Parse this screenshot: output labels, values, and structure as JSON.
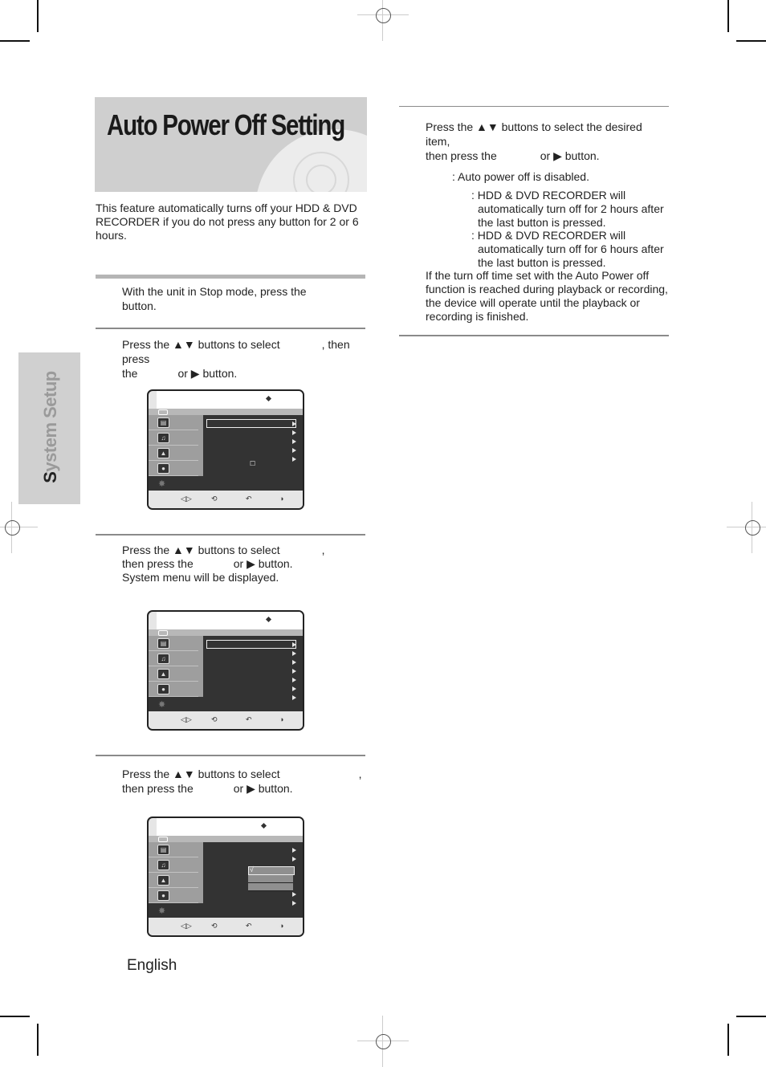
{
  "page": {
    "title": "Auto Power Off Setting",
    "section_tab": "System Setup",
    "language_label": "English",
    "intro": "This feature automatically turns off your HDD & DVD RECORDER if you do not press any button for 2 or 6 hours."
  },
  "steps": [
    {
      "line1": "With the unit in Stop mode, press the",
      "line2": "button."
    },
    {
      "line1": "Press the ▲▼ buttons to select",
      "line1b": ", then press",
      "line2a": "the",
      "line2b": "or ▶ button."
    },
    {
      "line1": "Press the ▲▼ buttons to select",
      "line1b": ",",
      "line2a": "then press the",
      "line2b": "or ▶ button.",
      "line3": "System menu will be displayed."
    },
    {
      "line1": "Press the ▲▼ buttons to select",
      "line1b": ",",
      "line2a": "then press the",
      "line2b": "or ▶ button."
    }
  ],
  "right_column": {
    "step": {
      "line1": "Press the ▲▼ buttons to select the desired item,",
      "line2a": "then press the",
      "line2b": "or ▶ button."
    },
    "options": [
      {
        "desc": ": Auto power off is disabled."
      },
      {
        "desc_lines": [
          ": HDD & DVD RECORDER will",
          "automatically turn off for 2 hours after",
          "the last button is pressed."
        ]
      },
      {
        "desc_lines": [
          ": HDD & DVD RECORDER will",
          "automatically turn off for 6 hours after",
          "the last button is pressed."
        ]
      }
    ],
    "note_lines": [
      "If the turn off time set with the Auto Power off",
      "function is reached during playback or recording,",
      "the device will operate until the playback or",
      "recording is finished."
    ]
  },
  "osd_screens": [
    {
      "name": "setup-menu",
      "item_count": 5,
      "has_lock_icon": true
    },
    {
      "name": "system-menu",
      "item_count": 7
    },
    {
      "name": "auto-power-off-submenu",
      "submenu_options": 3,
      "checked_option_index": 0
    }
  ],
  "osd_icons": {
    "top_indicator": "◆",
    "left_items": [
      "▤",
      "♫",
      "▲",
      "●"
    ],
    "gear": "✸",
    "check": "√",
    "lock": "☐",
    "bottom": [
      "◁▷",
      "⟲",
      "↶",
      "◑"
    ]
  }
}
